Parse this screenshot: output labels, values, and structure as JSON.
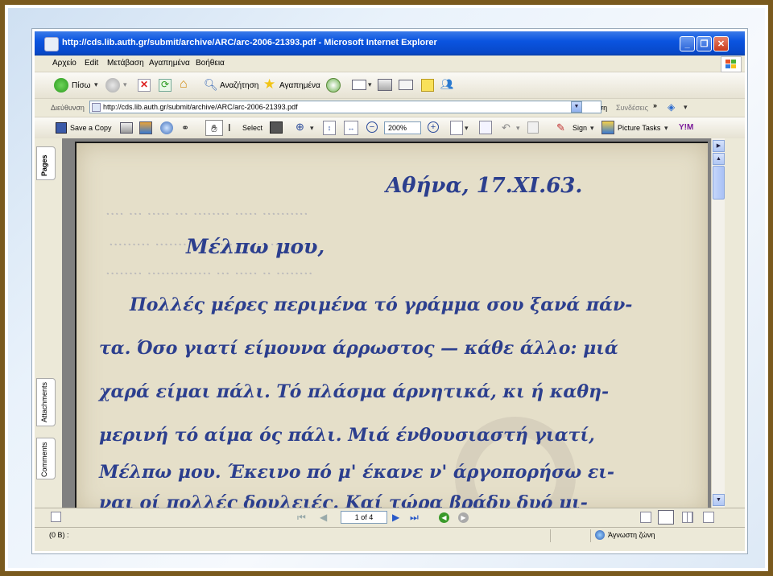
{
  "window": {
    "title": "http://cds.lib.auth.gr/submit/archive/ARC/arc-2006-21393.pdf - Microsoft Internet Explorer"
  },
  "menu": [
    "Αρχείο",
    "Edit",
    "Μετάβαση",
    "Αγαπημένα",
    "Βοήθεια"
  ],
  "toolbar": {
    "back_label": "Πίσω",
    "search_label": "Αναζήτηση",
    "favorites_label": "Αγαπημένα"
  },
  "address": {
    "label": "Διεύθυνση",
    "url": "http://cds.lib.auth.gr/submit/archive/ARC/arc-2006-21393.pdf",
    "go_label": "Μετάβαση",
    "links_label": "Συνδέσεις"
  },
  "pdf_toolbar": {
    "save_copy_label": "Save a Copy",
    "select_label": "Select",
    "zoom_value": "200%",
    "sign_label": "Sign",
    "picture_tasks_label": "Picture Tasks"
  },
  "side_tabs": {
    "pages": "Pages",
    "attachments": "Attachments",
    "comments": "Comments"
  },
  "document": {
    "lines": [
      "Αθήνα, 17.XI.63.",
      "Μέλπω μου,",
      "Πολλές μέρες περιμένα τό γράμμα σου ξανά πάν-",
      "τα. Όσο γιατί είμουνα άρρωστος — κάθε άλλο: μιά",
      "χαρά είμαι πάλι. Τό πλάσμα άρνητικά, κι ή καθη-",
      "μερινή τό αίμα ός πάλι. Μιά ένθουσιαστή γιατί,",
      "Μέλπω μου. Έκεινο πό μ' έκανε ν' άργοπορήσω ει-",
      "ναι οί πολλές δουλειές. Καί τώρα βράδυ δυό μι-"
    ]
  },
  "nav": {
    "page_indicator": "1 of 4"
  },
  "status": {
    "left_text": "(0 B) :",
    "zone_text": "Άγνωστη ζώνη"
  }
}
